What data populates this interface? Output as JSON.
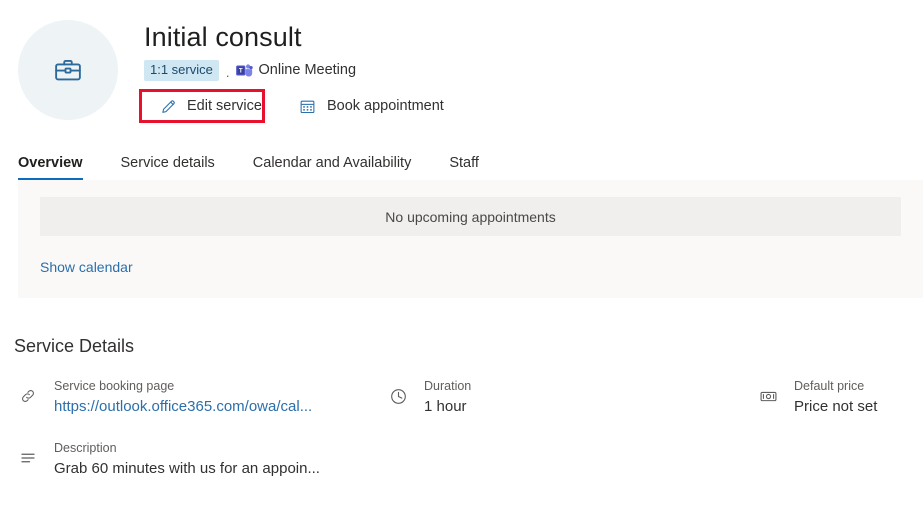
{
  "header": {
    "avatar_icon": "briefcase-icon",
    "title": "Initial consult",
    "badge": "1:1 service",
    "separator": ".",
    "meeting_icon": "microsoft-teams-icon",
    "meeting_type": "Online Meeting",
    "actions": {
      "edit_service": {
        "label": "Edit service",
        "icon": "pencil-icon",
        "highlighted": true,
        "highlight_color": "#e8112d"
      },
      "book_appointment": {
        "label": "Book appointment",
        "icon": "calendar-icon"
      }
    }
  },
  "tabs": [
    {
      "label": "Overview",
      "active": true
    },
    {
      "label": "Service details",
      "active": false
    },
    {
      "label": "Calendar and Availability",
      "active": false
    },
    {
      "label": "Staff",
      "active": false
    }
  ],
  "appointments": {
    "empty_message": "No upcoming appointments",
    "show_calendar_label": "Show calendar"
  },
  "service_details": {
    "section_title": "Service Details",
    "items": [
      {
        "icon": "link-icon",
        "label": "Service booking page",
        "value": "https://outlook.office365.com/owa/cal...",
        "is_link": true
      },
      {
        "icon": "description-icon",
        "label": "Description",
        "value": "Grab 60 minutes with us for an appoin...",
        "is_link": false
      },
      {
        "icon": "clock-icon",
        "label": "Duration",
        "value": "1 hour",
        "is_link": false
      },
      {
        "icon": "money-icon",
        "label": "Default price",
        "value": "Price not set",
        "is_link": false
      }
    ]
  },
  "colors": {
    "accent": "#0f6cbd",
    "link": "#2b6fab",
    "badge_bg": "#cfe7f3",
    "highlight": "#e8112d",
    "avatar_bg": "#eef3f6",
    "section_bg": "#faf9f8",
    "panel_bg": "#f0efee"
  }
}
